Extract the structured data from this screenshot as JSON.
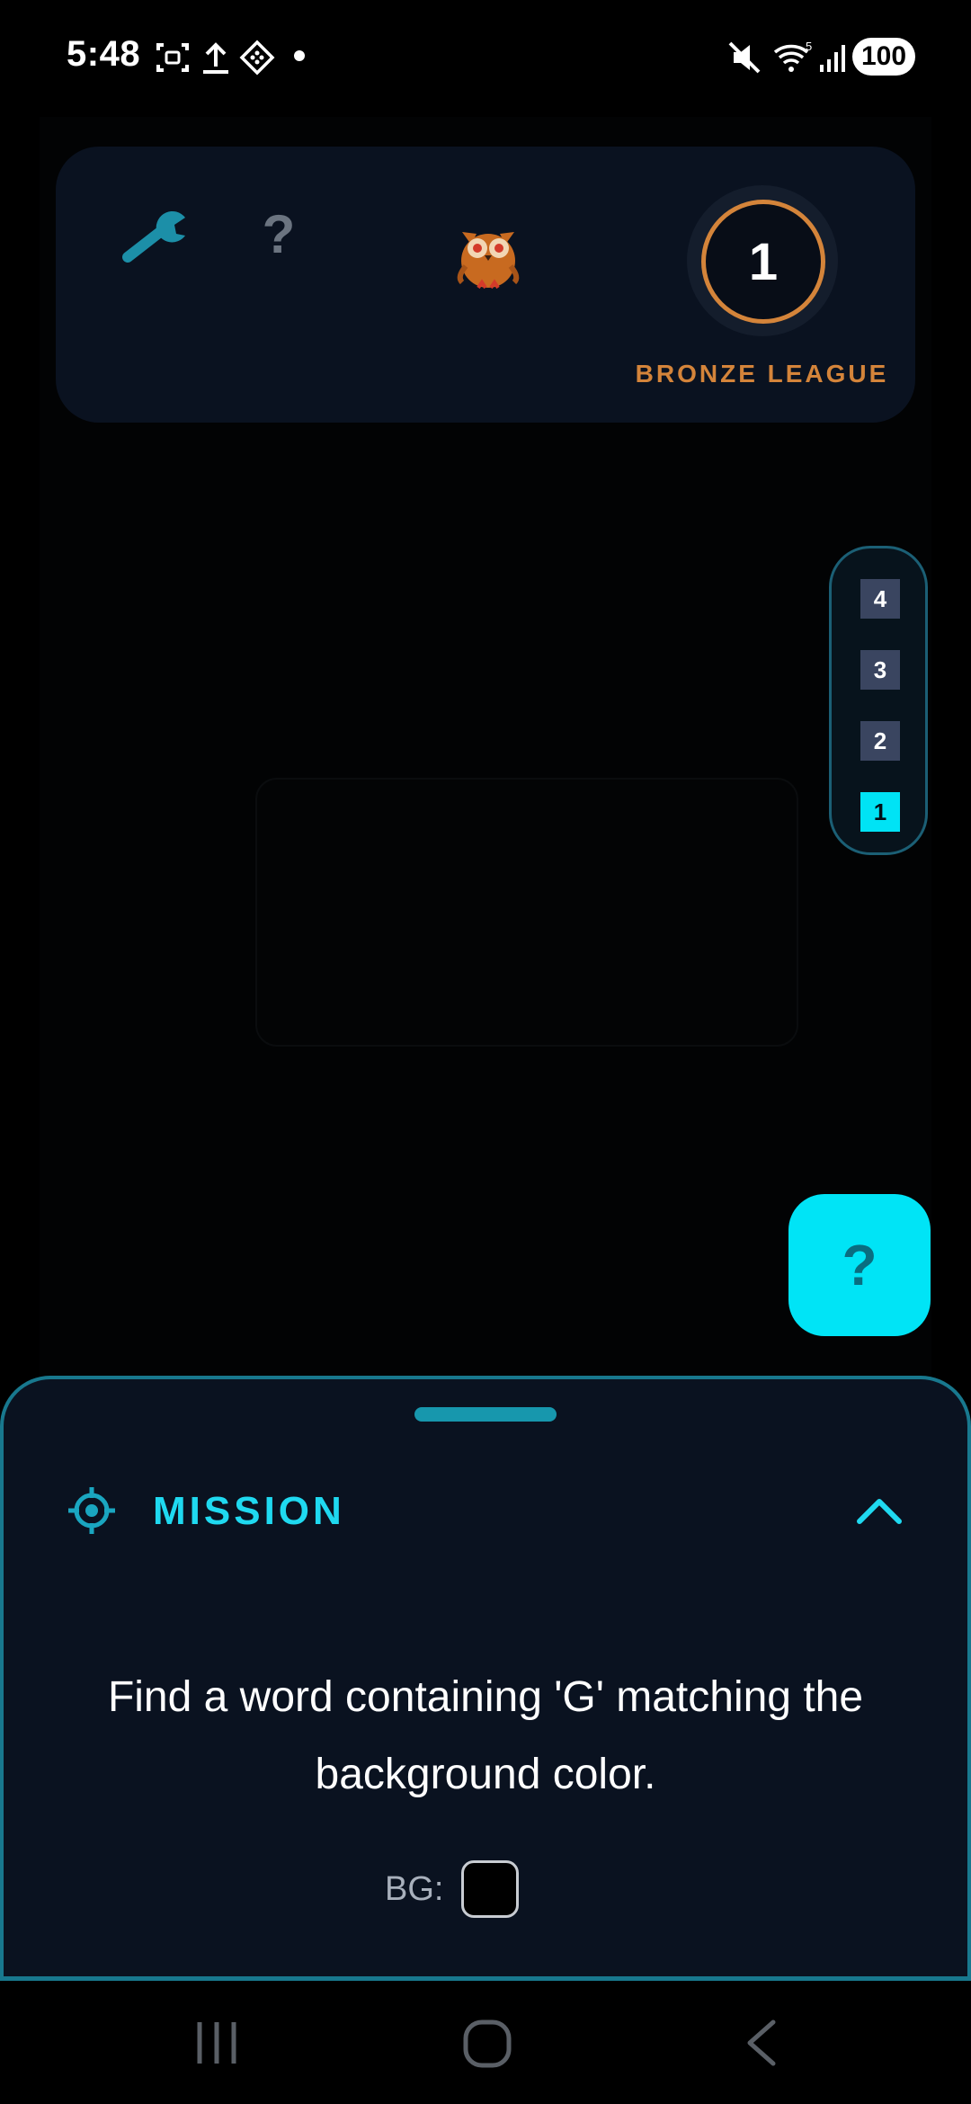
{
  "status_bar": {
    "time": "5:48",
    "battery": "100",
    "icons": [
      "screenshot-icon",
      "upload-icon",
      "app-icon",
      "dot-icon",
      "mute-icon",
      "wifi-icon",
      "signal-icon",
      "battery-icon"
    ]
  },
  "top_panel": {
    "tools_icon": "wrench-icon",
    "help_text": "?",
    "mascot": "owl-icon",
    "level": "1",
    "league": "BRONZE LEAGUE"
  },
  "level_selector": {
    "levels": [
      "4",
      "3",
      "2",
      "1"
    ],
    "active": "1"
  },
  "hint_button": {
    "label": "?"
  },
  "mission": {
    "title": "MISSION",
    "text": "Find a word containing 'G' matching the background color.",
    "bg_label": "BG:",
    "bg_color": "#000000"
  },
  "colors": {
    "accent": "#00e4f6",
    "league": "#d4843a",
    "panel": "#0a1220"
  }
}
